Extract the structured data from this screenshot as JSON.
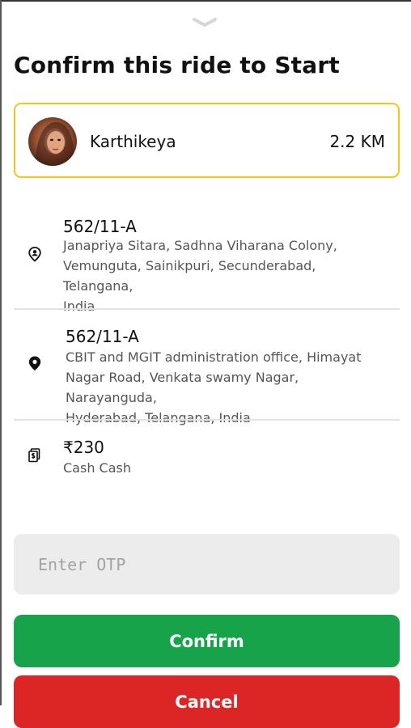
{
  "sheet": {
    "title": "Confirm this ride to Start"
  },
  "rider": {
    "name": "Karthikeya",
    "distance": "2.2 KM",
    "avatar_icon": "avatar-photo",
    "border_color": "#f2c619"
  },
  "pickup": {
    "icon": "pickup-location-icon",
    "code": "562/11-A",
    "address_lines": [
      "Janapriya Sitara, Sadhna Viharana Colony,",
      "Vemunguta, Sainikpuri, Secunderabad, Telangana,",
      "India"
    ]
  },
  "dropoff": {
    "icon": "dropoff-location-icon",
    "code": "562/11-A",
    "address_lines": [
      "CBIT and MGIT administration office, Himayat",
      "Nagar Road, Venkata swamy Nagar, Narayanguda,",
      "Hyderabad, Telangana, India"
    ]
  },
  "fare": {
    "icon": "cash-icon",
    "amount": "₹230",
    "method": "Cash Cash"
  },
  "otp": {
    "placeholder": "Enter OTP",
    "value": ""
  },
  "actions": {
    "confirm_label": "Confirm",
    "cancel_label": "Cancel",
    "confirm_color": "#17a34a",
    "cancel_color": "#dc2626"
  }
}
